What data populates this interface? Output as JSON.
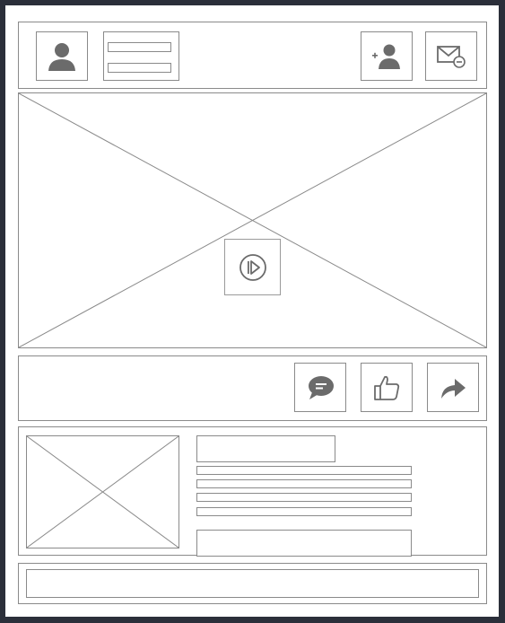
{
  "colors": {
    "frame": "#2b2f3a",
    "stroke": "#8a8a8a",
    "icon": "#6b6b6b",
    "background": "#ffffff"
  },
  "header": {
    "avatar_icon": "user-icon",
    "add_user_icon": "add-user-icon",
    "message_icon": "mail-remove-icon"
  },
  "video": {
    "play_icon": "play-circle-icon"
  },
  "actions": {
    "comment_icon": "comment-icon",
    "like_icon": "thumbs-up-icon",
    "share_icon": "share-arrow-icon"
  },
  "related": {
    "thumbnail_icon": "image-placeholder-icon"
  }
}
